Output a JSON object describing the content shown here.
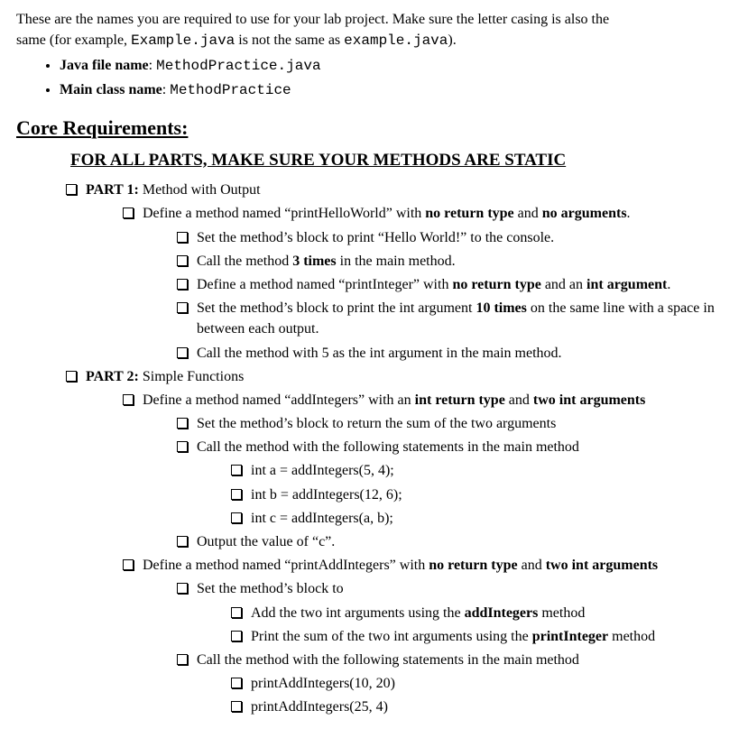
{
  "intro": {
    "line1a": "These are the names you are required to use for your lab project. Make sure the letter casing is also the",
    "line2a": "same (for example, ",
    "code1": "Example.java",
    "line2b": " is not the same as ",
    "code2": "example.java",
    "line2c": ")."
  },
  "bullets": {
    "b1_label": "Java file name",
    "b1_value": "MethodPractice.java",
    "b2_label": "Main class name",
    "b2_value": "MethodPractice"
  },
  "core_heading": "Core Requirements:",
  "static_heading": "FOR ALL PARTS, MAKE SURE YOUR METHODS ARE STATIC",
  "items": {
    "p1_title_a": "PART 1:",
    "p1_title_b": " Method with Output",
    "p1_1a": "Define a method named “printHelloWorld” with ",
    "p1_1b": "no return type",
    "p1_1c": " and ",
    "p1_1d": "no arguments",
    "p1_1e": ".",
    "p1_1_1": "Set the method’s block to print “Hello World!” to the console.",
    "p1_1_2a": "Call the method ",
    "p1_1_2b": "3 times",
    "p1_1_2c": " in the main method.",
    "p1_1_3a": "Define a method named “printInteger” with ",
    "p1_1_3b": "no return type",
    "p1_1_3c": " and an ",
    "p1_1_3d": "int argument",
    "p1_1_3e": ".",
    "p1_1_4a": "Set the method’s block to print the int argument ",
    "p1_1_4b": "10 times",
    "p1_1_4c": " on the same line with a space in between each output.",
    "p1_1_5": "Call the method with 5 as the int argument in the main method.",
    "p2_title_a": "PART 2:",
    "p2_title_b": " Simple Functions",
    "p2_1a": "Define a method named “addIntegers” with an ",
    "p2_1b": "int return type",
    "p2_1c": " and ",
    "p2_1d": "two int arguments",
    "p2_1_1": "Set the method’s block to return the sum of the two arguments",
    "p2_1_2": "Call the method with the following statements in the main method",
    "p2_1_2_1": "int a = addIntegers(5, 4);",
    "p2_1_2_2": "int b = addIntegers(12, 6);",
    "p2_1_2_3": "int c = addIntegers(a, b);",
    "p2_1_3": "Output the value of “c”.",
    "p2_2a": "Define a method named “printAddIntegers” with ",
    "p2_2b": "no return type",
    "p2_2c": " and ",
    "p2_2d": "two int arguments",
    "p2_2_1": "Set the method’s block to",
    "p2_2_1_1a": "Add the two int arguments using the ",
    "p2_2_1_1b": "addIntegers",
    "p2_2_1_1c": " method",
    "p2_2_1_2a": "Print the sum of the two int arguments using the ",
    "p2_2_1_2b": "printInteger",
    "p2_2_1_2c": " method",
    "p2_2_2": "Call the method with the following statements in the main method",
    "p2_2_2_1": "printAddIntegers(10, 20)",
    "p2_2_2_2": "printAddIntegers(25, 4)"
  }
}
